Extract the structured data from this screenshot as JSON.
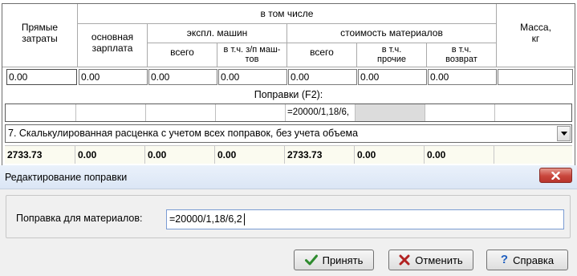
{
  "grid": {
    "header": {
      "direct_costs": "Прямые затраты",
      "including": "в том числе",
      "base_salary": "основная зарплата",
      "machine_operation": "экспл. машин",
      "machine_total": "всего",
      "machine_salary": "в т.ч. з/п маш-тов",
      "materials_cost": "стоимость материалов",
      "materials_total": "всего",
      "materials_other": "в т.ч. прочие",
      "materials_return": "в т.ч. возврат",
      "mass": "Масса, кг"
    },
    "values": [
      "0.00",
      "0.00",
      "0.00",
      "0.00",
      "0.00",
      "0.00",
      "0.00"
    ],
    "corrections_label": "Поправки (F2):",
    "corrections_value": "=20000/1,18/6,",
    "dropdown_selected": "7. Скалькулированная расценка с учетом всех поправок, без учета объема",
    "totals": [
      "2733.73",
      "0.00",
      "0.00",
      "0.00",
      "2733.73",
      "0.00",
      "0.00"
    ]
  },
  "dialog": {
    "title": "Редактирование поправки",
    "field_label": "Поправка для материалов:",
    "field_value": "=20000/1,18/6,2",
    "buttons": {
      "accept": "Принять",
      "cancel": "Отменить",
      "help": "Справка"
    }
  },
  "colors": {
    "total_row_bg": "#fbfbf0",
    "accept_icon": "#2e8b2e",
    "cancel_icon": "#b22222",
    "help_icon": "#1f5fbf",
    "close_button": "#c9463d"
  },
  "icons": {
    "accept": "check-icon",
    "cancel": "x-icon",
    "help": "question-icon",
    "dropdown": "chevron-down-icon",
    "close": "close-icon"
  }
}
